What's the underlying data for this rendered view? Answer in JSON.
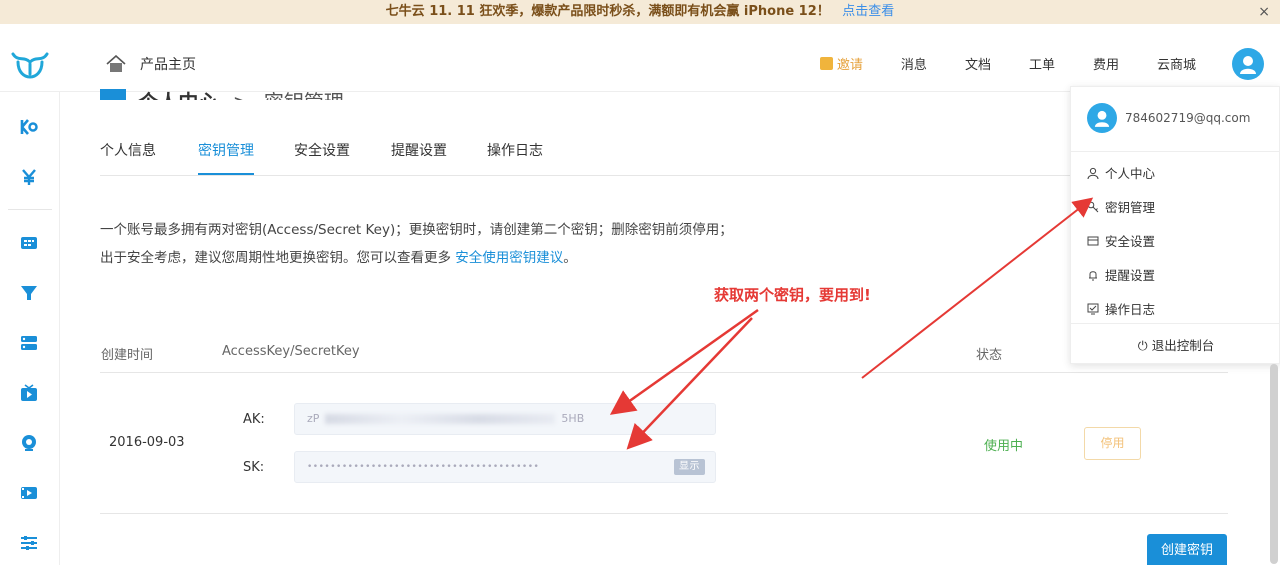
{
  "banner": {
    "text": "七牛云 11. 11 狂欢季，爆款产品限时秒杀，满额即有机会赢 iPhone 12！",
    "link": "点击查看",
    "close": "×"
  },
  "header": {
    "home_label": "产品主页",
    "nav": [
      "邀请",
      "消息",
      "文档",
      "工单",
      "费用",
      "云商城"
    ]
  },
  "breadcrumb": {
    "title": "个人中心",
    "sep": ">",
    "current": "密钥管理"
  },
  "tabs": [
    "个人信息",
    "密钥管理",
    "安全设置",
    "提醒设置",
    "操作日志"
  ],
  "active_tab": "密钥管理",
  "description": {
    "text": "一个账号最多拥有两对密钥(Access/Secret Key)；更换密钥时，请创建第二个密钥；删除密钥前须停用；出于安全考虑，建议您周期性地更换密钥。您可以查看更多",
    "link": "安全使用密钥建议",
    "end": "。"
  },
  "annotation": "获取两个密钥，要用到!",
  "table": {
    "headers": {
      "created": "创建时间",
      "keys": "AccessKey/SecretKey",
      "status": "状态"
    },
    "row": {
      "date": "2016-09-03",
      "ak_label": "AK:",
      "ak_prefix": "zP",
      "ak_suffix": "5HB",
      "sk_label": "SK:",
      "sk_value": "••••••••••••••••••••••••••••••••••••••••",
      "show_label": "显示",
      "status": "使用中",
      "disable_label": "停用"
    }
  },
  "create_button": "创建密钥",
  "dropdown": {
    "email": "784602719@qq.com",
    "items": [
      "个人中心",
      "密钥管理",
      "安全设置",
      "提醒设置",
      "操作日志"
    ],
    "logout": "退出控制台"
  },
  "colors": {
    "accent": "#1a8fd8",
    "annotation": "#e53935",
    "status_ok": "#4caf50",
    "invite": "#e6a23c"
  }
}
